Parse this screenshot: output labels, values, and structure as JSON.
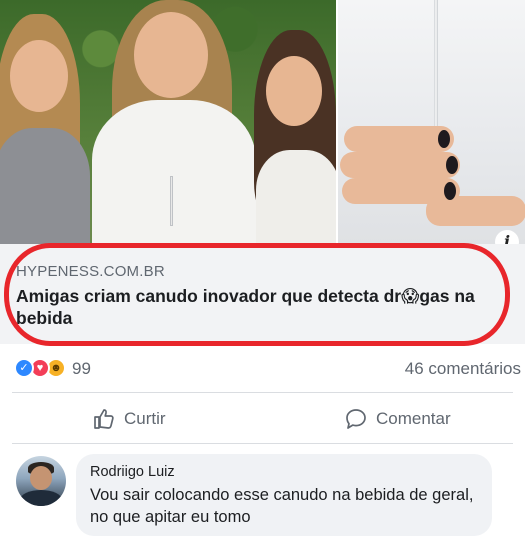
{
  "link_preview": {
    "source": "HYPENESS.COM.BR",
    "title": "Amigas criam canudo inovador que detecta dr😱gas na bebida"
  },
  "info_icon": "i",
  "reactions": {
    "icons": [
      "like-icon",
      "love-icon",
      "haha-icon"
    ],
    "count": "99",
    "comments": "46 comentários"
  },
  "actions": {
    "like_label": "Curtir",
    "comment_label": "Comentar"
  },
  "comment": {
    "author": "Rodriigo Luiz",
    "text": "Vou sair colocando esse canudo na bebida de geral, no que apitar eu tomo"
  },
  "colors": {
    "highlight": "#e8262b",
    "like": "#2d88ff",
    "love": "#f33e58",
    "haha": "#f7b125",
    "secondary_text": "#606770",
    "preview_bg": "#f2f3f5"
  }
}
